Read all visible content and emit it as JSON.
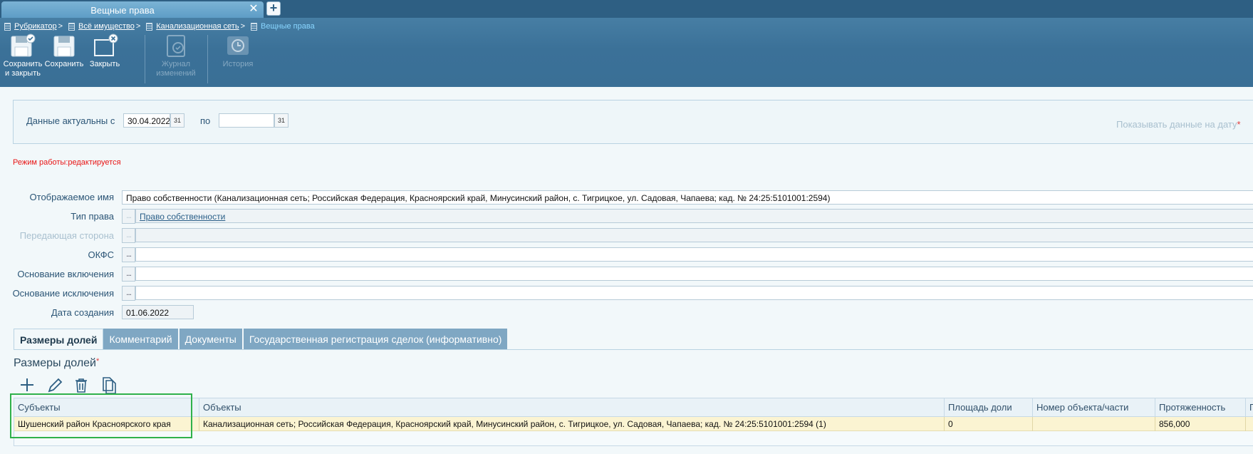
{
  "window": {
    "tab_title": "Вещные права",
    "tab_close": "✕",
    "tab_add": "+"
  },
  "breadcrumb": [
    {
      "label": "Рубрикатор",
      "type": "link"
    },
    {
      "label": "Всё имущество",
      "type": "link"
    },
    {
      "label": "Канализационная сеть",
      "type": "link"
    },
    {
      "label": "Вещные права",
      "type": "current"
    }
  ],
  "breadcrumb_separator": ">",
  "toolbar": {
    "save_close_label": "Сохранить\nи закрыть",
    "save_label": "Сохранить",
    "close_label": "Закрыть",
    "journal_label": "Журнал\nизменений",
    "history_label": "История"
  },
  "date_panel": {
    "actual_from_label": "Данные актуальны с",
    "actual_from_value": "30.04.2022",
    "to_label": "по",
    "to_value": "",
    "calendar_glyph": "31",
    "show_on_date_label": "Показывать данные на дату"
  },
  "mode_text": "Режим работы:редактируется",
  "form": {
    "display_name_label": "Отображаемое имя",
    "display_name_value": "Право собственности (Канализационная сеть; Российская Федерация, Красноярский край, Минусинский район, с. Тигрицкое, ул. Садовая, Чапаева; кад. № 24:25:5101001:2594)",
    "right_type_label": "Тип права",
    "right_type_value": "Право собственности",
    "transferring_party_label": "Передающая сторона",
    "okfs_label": "ОКФС",
    "inclusion_basis_label": "Основание включения",
    "exclusion_basis_label": "Основание исключения",
    "creation_date_label": "Дата создания",
    "creation_date_value": "01.06.2022",
    "lookup_glyph": "..."
  },
  "tabs": [
    {
      "label": "Размеры долей",
      "active": true
    },
    {
      "label": "Комментарий",
      "active": false
    },
    {
      "label": "Документы",
      "active": false
    },
    {
      "label": "Государственная регистрация сделок (информативно)",
      "active": false
    }
  ],
  "shares": {
    "title": "Размеры долей",
    "required_mark": "*",
    "columns": [
      "Субъекты",
      "Объекты",
      "Площадь доли",
      "Номер объекта/части",
      "Протяженность",
      "Пере"
    ],
    "rows": [
      [
        "Шушенский район Красноярского края",
        "Канализационная сеть; Российская Федерация, Красноярский край, Минусинский район, с. Тигрицкое, ул. Садовая, Чапаева; кад. № 24:25:5101001:2594 (1)",
        "0",
        "",
        "856,000",
        ""
      ]
    ]
  },
  "colors": {
    "accent": "#3b7198",
    "mode_text": "#e81515",
    "row_highlight": "#fbf4d2",
    "selection_frame": "#2fb14a"
  },
  "icons": [
    "save-close-icon",
    "save-icon",
    "close-window-icon",
    "journal-icon",
    "history-icon",
    "add-icon",
    "edit-icon",
    "delete-icon",
    "copy-icon",
    "calendar-icon",
    "document-icon"
  ]
}
